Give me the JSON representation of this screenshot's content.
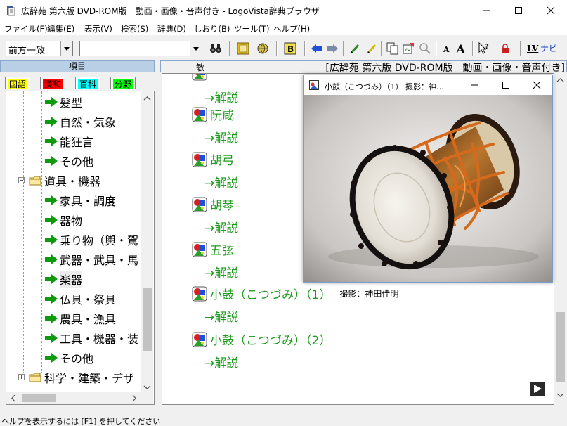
{
  "window": {
    "title": "広辞苑 第六版 DVD-ROM版－動画・画像・音声付き - LogoVista辞典ブラウザ",
    "minimize": "—",
    "maximize": "☐",
    "close": "✕"
  },
  "menu": [
    "ファイル(F)",
    "編集(E)",
    "表示(V)",
    "検索(S)",
    "辞典(D)",
    "しおり(B)",
    "ツール(T)",
    "ヘルプ(H)"
  ],
  "toolbar": {
    "search_mode": "前方一致",
    "search_text": "",
    "lv_navi_label": "LVナビ"
  },
  "left_panel": {
    "header": "項目",
    "tabs": [
      {
        "label": "国語",
        "color": "#ffff00"
      },
      {
        "label": "漢和",
        "color": "#ff0000"
      },
      {
        "label": "百科",
        "color": "#00ffff"
      },
      {
        "label": "分野",
        "color": "#00ff00"
      }
    ],
    "tree": [
      {
        "label": "髪型",
        "level": 2,
        "kind": "leaf"
      },
      {
        "label": "自然・気象",
        "level": 2,
        "kind": "leaf"
      },
      {
        "label": "能狂言",
        "level": 2,
        "kind": "leaf"
      },
      {
        "label": "その他",
        "level": 2,
        "kind": "leaf"
      },
      {
        "label": "道具・機器",
        "level": 1,
        "kind": "folder",
        "expander": "−"
      },
      {
        "label": "家具・調度",
        "level": 2,
        "kind": "leaf"
      },
      {
        "label": "器物",
        "level": 2,
        "kind": "leaf"
      },
      {
        "label": "乗り物（輿・駕",
        "level": 2,
        "kind": "leaf"
      },
      {
        "label": "武器・武具・馬",
        "level": 2,
        "kind": "leaf"
      },
      {
        "label": "楽器",
        "level": 2,
        "kind": "leaf",
        "selected": true
      },
      {
        "label": "仏具・祭具",
        "level": 2,
        "kind": "leaf"
      },
      {
        "label": "農具・漁具",
        "level": 2,
        "kind": "leaf"
      },
      {
        "label": "工具・機器・装",
        "level": 2,
        "kind": "leaf"
      },
      {
        "label": "その他",
        "level": 2,
        "kind": "leaf"
      },
      {
        "label": "科学・建築・デザ",
        "level": 1,
        "kind": "folder",
        "expander": "+"
      }
    ]
  },
  "right_panel": {
    "keyword": "敏",
    "dictionary": "[広辞苑 第六版 DVD-ROM版－動画・画像・音声付き]",
    "link_label": "→解説",
    "entries": [
      {
        "title": "",
        "credit": ""
      },
      {
        "title": "阮咸",
        "credit": ""
      },
      {
        "title": "胡弓",
        "credit": ""
      },
      {
        "title": "胡琴",
        "credit": ""
      },
      {
        "title": "五弦",
        "credit": ""
      },
      {
        "title": "小鼓（こつづみ）（1）",
        "credit": "撮影：神田佳明"
      },
      {
        "title": "小鼓（こつづみ）（2）",
        "credit": ""
      }
    ]
  },
  "popup": {
    "title": "小鼓（こつづみ）（1）  撮影：神…"
  },
  "status": "ヘルプを表示するには [F1] を押してください"
}
